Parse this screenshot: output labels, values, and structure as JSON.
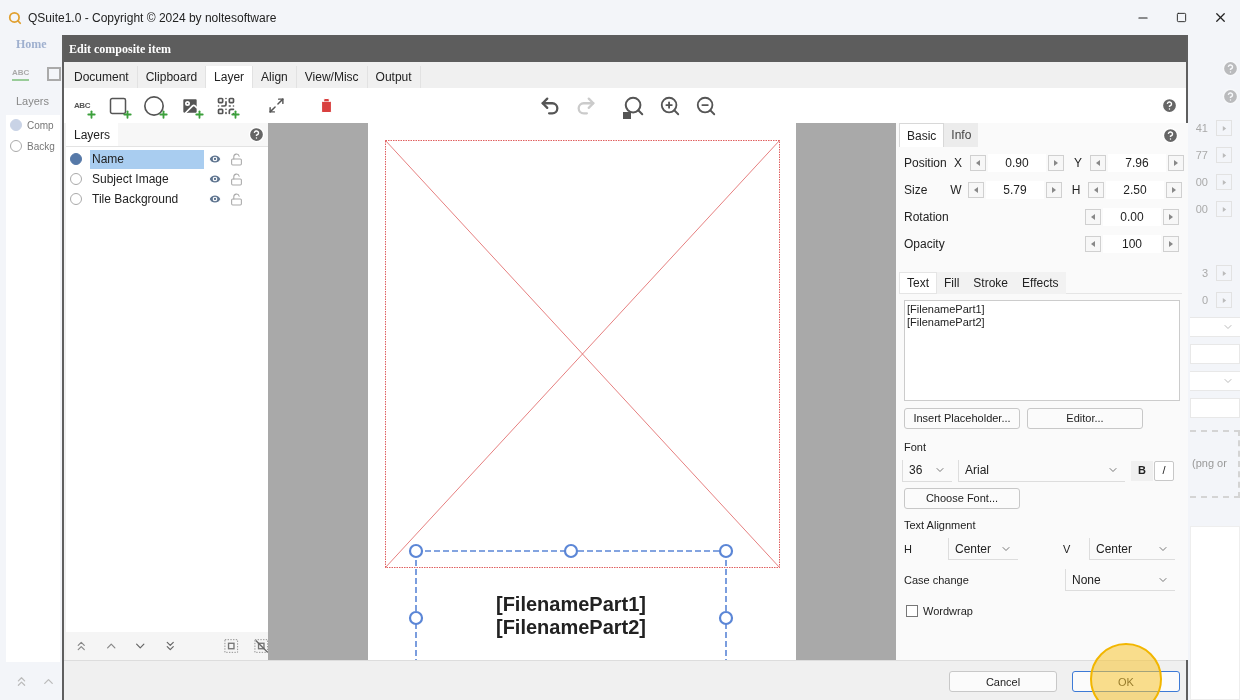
{
  "app": {
    "title": "QSuite1.0 - Copyright © 2024 by noltesoftware"
  },
  "background_app": {
    "home_tab": "Home",
    "text_tool_label": "ABC",
    "layers_label": "Layers",
    "layers": [
      {
        "label": "Comp",
        "selected": true
      },
      {
        "label": "Backg",
        "selected": false
      }
    ],
    "values": [
      {
        "kind": "spin",
        "value": "41"
      },
      {
        "kind": "spin",
        "value": "77"
      },
      {
        "kind": "spin",
        "value": "00"
      },
      {
        "kind": "spin",
        "value": "00"
      },
      {
        "kind": "gap"
      },
      {
        "kind": "spin",
        "value": "3"
      },
      {
        "kind": "spin",
        "value": "0"
      },
      {
        "kind": "combo"
      },
      {
        "kind": "field"
      },
      {
        "kind": "combo"
      },
      {
        "kind": "field"
      }
    ],
    "drop_hint": "(png or"
  },
  "dialog": {
    "title": "Edit composite item",
    "tabs": [
      {
        "label": "Document",
        "selected": false
      },
      {
        "label": "Clipboard",
        "selected": false
      },
      {
        "label": "Layer",
        "selected": true
      },
      {
        "label": "Align",
        "selected": false
      },
      {
        "label": "View/Misc",
        "selected": false
      },
      {
        "label": "Output",
        "selected": false
      }
    ],
    "toolbar": [
      {
        "kind": "add-text",
        "label": "ABC",
        "disabled": false
      },
      {
        "kind": "add-rectangle",
        "disabled": false
      },
      {
        "kind": "add-ellipse",
        "disabled": false
      },
      {
        "kind": "add-image",
        "disabled": false
      },
      {
        "kind": "add-qr",
        "disabled": false
      },
      {
        "kind": "fit",
        "disabled": false
      },
      {
        "kind": "delete",
        "disabled": false
      },
      {
        "kind": "undo",
        "disabled": false
      },
      {
        "kind": "redo",
        "disabled": true
      },
      {
        "kind": "zoom-page",
        "disabled": false
      },
      {
        "kind": "zoom-in",
        "disabled": false
      },
      {
        "kind": "zoom-out",
        "disabled": false
      }
    ],
    "layers_panel": {
      "title": "Layers",
      "layers": [
        {
          "name": "Name",
          "selected": true
        },
        {
          "name": "Subject Image",
          "selected": false
        },
        {
          "name": "Tile Background",
          "selected": false
        }
      ]
    },
    "canvas": {
      "text_lines": [
        "[FilenamePart1]",
        "[FilenamePart2]"
      ]
    },
    "properties": {
      "tabs": [
        {
          "label": "Basic",
          "selected": true
        },
        {
          "label": "Info",
          "selected": false
        }
      ],
      "rows": [
        {
          "label": "Position",
          "fields": [
            {
              "label": "X",
              "value": "0.90"
            },
            {
              "label": "Y",
              "value": "7.96"
            }
          ]
        },
        {
          "label": "Size",
          "fields": [
            {
              "label": "W",
              "value": "5.79"
            },
            {
              "label": "H",
              "value": "2.50"
            }
          ]
        },
        {
          "label": "Rotation",
          "fields": [
            {
              "value": "0.00"
            }
          ]
        },
        {
          "label": "Opacity",
          "fields": [
            {
              "value": "100"
            }
          ]
        }
      ],
      "sub_tabs": [
        {
          "label": "Text",
          "selected": true
        },
        {
          "label": "Fill",
          "selected": false
        },
        {
          "label": "Stroke",
          "selected": false
        },
        {
          "label": "Effects",
          "selected": false
        }
      ],
      "text_value": "[FilenamePart1]\n[FilenamePart2]",
      "insert_placeholder": "Insert Placeholder...",
      "editor": "Editor...",
      "font_label": "Font",
      "font_size": "36",
      "font_family": "Arial",
      "bold_label": "B",
      "italic_label": "/",
      "choose_font": "Choose Font...",
      "alignment_label": "Text Alignment",
      "h_label": "H",
      "h_value": "Center",
      "v_label": "V",
      "v_value": "Center",
      "case_label": "Case change",
      "case_value": "None",
      "wordwrap": {
        "label": "Wordwrap",
        "checked": false
      }
    },
    "buttons": [
      {
        "label": "Cancel",
        "kind": "cancel",
        "highlighted": false
      },
      {
        "label": "OK",
        "kind": "default",
        "highlighted": true
      }
    ]
  }
}
